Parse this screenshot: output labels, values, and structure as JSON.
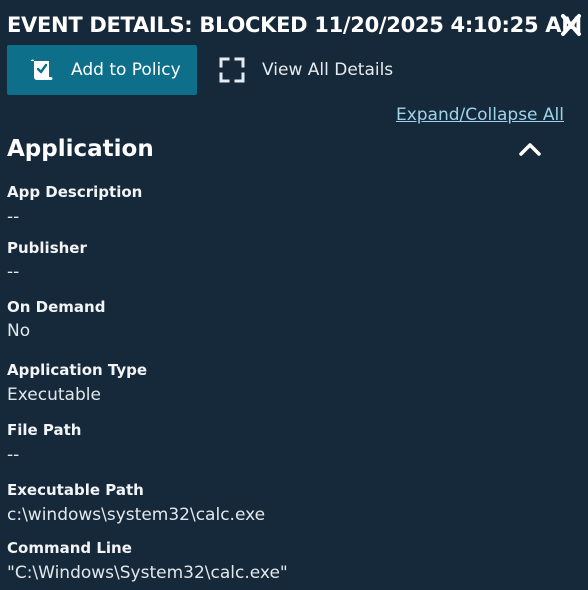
{
  "header": {
    "title": "EVENT DETAILS: BLOCKED 11/20/2025 4:10:25 AM"
  },
  "toolbar": {
    "add_to_policy_label": "Add to Policy",
    "view_all_details_label": "View All Details"
  },
  "expand_collapse_label": "Expand/Collapse All",
  "section": {
    "title": "Application",
    "fields": [
      {
        "label": "App Description",
        "value": "--"
      },
      {
        "label": "Publisher",
        "value": "--"
      },
      {
        "label": "On Demand",
        "value": "No"
      },
      {
        "label": "Application Type",
        "value": "Executable"
      },
      {
        "label": "File Path",
        "value": "--"
      },
      {
        "label": "Executable Path",
        "value": "c:\\windows\\system32\\calc.exe"
      },
      {
        "label": "Command Line",
        "value": "\"C:\\Windows\\System32\\calc.exe\""
      }
    ]
  },
  "colors": {
    "background": "#16293b",
    "primary_button": "#0d6f8a",
    "link": "#9ed4ea"
  },
  "icons": {
    "close": "close-icon",
    "add_to_policy": "policy-scroll-check-icon",
    "view_all": "expand-corners-icon",
    "collapse": "chevron-up-icon"
  }
}
